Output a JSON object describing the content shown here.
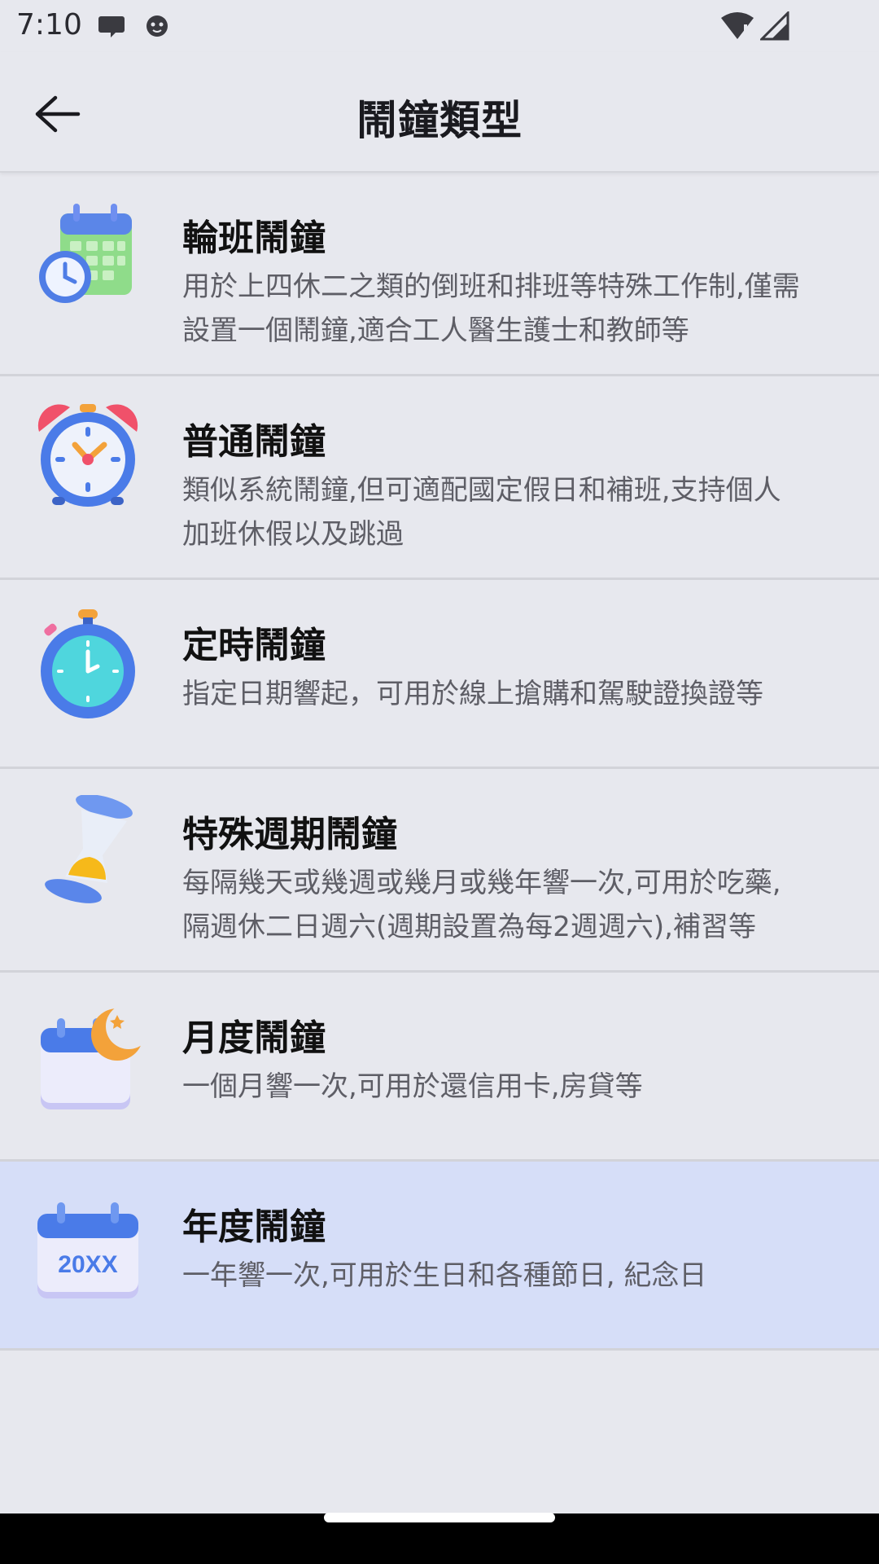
{
  "status_bar": {
    "time": "7:10",
    "notification_icons": [
      "chat-bubble-icon",
      "cat-face-icon"
    ],
    "system_icons": [
      "wifi-icon",
      "cell-signal-icon"
    ]
  },
  "app_bar": {
    "title": "鬧鐘類型",
    "back_icon": "arrow-left-icon"
  },
  "alarm_types": [
    {
      "title": "輪班鬧鐘",
      "description_line1": "用於上四休二之類的倒班和排班等特殊工作制,僅需",
      "description_line2": "設置一個鬧鐘,適合工人醫生護士和教師等",
      "icon": "calendar-clock-icon"
    },
    {
      "title": "普通鬧鐘",
      "description_line1": "類似系統鬧鐘,但可適配國定假日和補班,支持個人",
      "description_line2": "加班休假以及跳過",
      "icon": "alarm-clock-icon"
    },
    {
      "title": "定時鬧鐘",
      "description_line1": "指定日期響起，可用於線上搶購和駕駛證換證等",
      "description_line2": "",
      "icon": "stopwatch-icon"
    },
    {
      "title": "特殊週期鬧鐘",
      "description_line1": "每隔幾天或幾週或幾月或幾年響一次,可用於吃藥,",
      "description_line2": "隔週休二日週六(週期設置為每2週週六),補習等",
      "icon": "hourglass-icon"
    },
    {
      "title": "月度鬧鐘",
      "description_line1": "一個月響一次,可用於還信用卡,房貸等",
      "description_line2": "",
      "icon": "calendar-moon-icon"
    },
    {
      "title": "年度鬧鐘",
      "description_line1": "一年響一次,可用於生日和各種節日, 紀念日",
      "description_line2": "",
      "icon": "calendar-year-icon",
      "icon_label": "20XX"
    }
  ],
  "colors": {
    "background": "#e7e8ee",
    "selected_row": "#d6def8",
    "accent_blue": "#4a7be8"
  }
}
